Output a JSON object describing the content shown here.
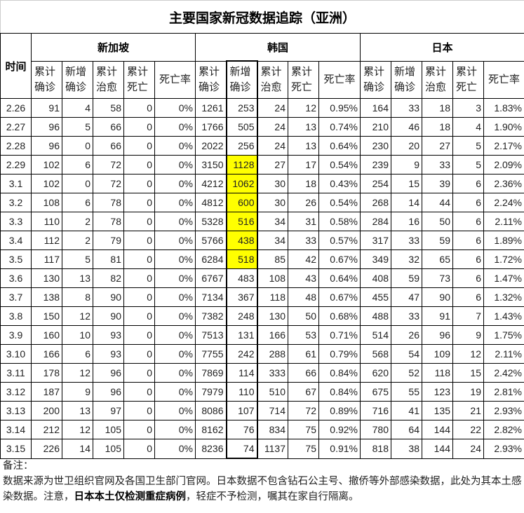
{
  "title": "主要国家新冠数据追踪（亚洲）",
  "time_header": "时间",
  "countries": [
    "新加坡",
    "韩国",
    "日本"
  ],
  "subheaders": [
    "累计确诊",
    "新增确诊",
    "累计治愈",
    "累计死亡",
    "死亡率"
  ],
  "highlight_color": "#ffff00",
  "highlighted_rows": [
    "2.29",
    "3.1",
    "3.2",
    "3.3",
    "3.4",
    "3.5"
  ],
  "rows": [
    [
      "2.26",
      "91",
      "4",
      "58",
      "0",
      "0%",
      "1261",
      "253",
      "24",
      "12",
      "0.95%",
      "164",
      "33",
      "18",
      "3",
      "1.83%"
    ],
    [
      "2.27",
      "96",
      "5",
      "66",
      "0",
      "0%",
      "1766",
      "505",
      "24",
      "13",
      "0.74%",
      "210",
      "46",
      "18",
      "4",
      "1.90%"
    ],
    [
      "2.28",
      "96",
      "0",
      "66",
      "0",
      "0%",
      "2022",
      "256",
      "24",
      "13",
      "0.64%",
      "230",
      "20",
      "27",
      "5",
      "2.17%"
    ],
    [
      "2.29",
      "102",
      "6",
      "72",
      "0",
      "0%",
      "3150",
      "1128",
      "27",
      "17",
      "0.54%",
      "239",
      "9",
      "33",
      "5",
      "2.09%"
    ],
    [
      "3.1",
      "102",
      "0",
      "72",
      "0",
      "0%",
      "4212",
      "1062",
      "30",
      "18",
      "0.43%",
      "254",
      "15",
      "39",
      "6",
      "2.36%"
    ],
    [
      "3.2",
      "108",
      "6",
      "78",
      "0",
      "0%",
      "4812",
      "600",
      "30",
      "26",
      "0.54%",
      "268",
      "14",
      "44",
      "6",
      "2.24%"
    ],
    [
      "3.3",
      "110",
      "2",
      "78",
      "0",
      "0%",
      "5328",
      "516",
      "34",
      "31",
      "0.58%",
      "284",
      "16",
      "50",
      "6",
      "2.11%"
    ],
    [
      "3.4",
      "112",
      "2",
      "79",
      "0",
      "0%",
      "5766",
      "438",
      "34",
      "33",
      "0.57%",
      "317",
      "33",
      "59",
      "6",
      "1.89%"
    ],
    [
      "3.5",
      "117",
      "5",
      "81",
      "0",
      "0%",
      "6284",
      "518",
      "85",
      "42",
      "0.67%",
      "349",
      "32",
      "65",
      "6",
      "1.72%"
    ],
    [
      "3.6",
      "130",
      "13",
      "82",
      "0",
      "0%",
      "6767",
      "483",
      "108",
      "43",
      "0.64%",
      "408",
      "59",
      "73",
      "6",
      "1.47%"
    ],
    [
      "3.7",
      "138",
      "8",
      "90",
      "0",
      "0%",
      "7134",
      "367",
      "118",
      "48",
      "0.67%",
      "455",
      "47",
      "90",
      "6",
      "1.32%"
    ],
    [
      "3.8",
      "150",
      "12",
      "90",
      "0",
      "0%",
      "7382",
      "248",
      "130",
      "50",
      "0.68%",
      "488",
      "33",
      "91",
      "7",
      "1.43%"
    ],
    [
      "3.9",
      "160",
      "10",
      "93",
      "0",
      "0%",
      "7513",
      "131",
      "166",
      "53",
      "0.71%",
      "514",
      "26",
      "96",
      "9",
      "1.75%"
    ],
    [
      "3.10",
      "166",
      "6",
      "93",
      "0",
      "0%",
      "7755",
      "242",
      "288",
      "61",
      "0.79%",
      "568",
      "54",
      "109",
      "12",
      "2.11%"
    ],
    [
      "3.11",
      "178",
      "12",
      "96",
      "0",
      "0%",
      "7869",
      "114",
      "333",
      "66",
      "0.84%",
      "620",
      "52",
      "118",
      "15",
      "2.42%"
    ],
    [
      "3.12",
      "187",
      "9",
      "96",
      "0",
      "0%",
      "7979",
      "110",
      "510",
      "67",
      "0.84%",
      "675",
      "55",
      "123",
      "19",
      "2.81%"
    ],
    [
      "3.13",
      "200",
      "13",
      "97",
      "0",
      "0%",
      "8086",
      "107",
      "714",
      "72",
      "0.89%",
      "716",
      "41",
      "135",
      "21",
      "2.93%"
    ],
    [
      "3.14",
      "212",
      "12",
      "105",
      "0",
      "0%",
      "8162",
      "76",
      "834",
      "75",
      "0.92%",
      "780",
      "64",
      "144",
      "22",
      "2.82%"
    ],
    [
      "3.15",
      "226",
      "14",
      "105",
      "0",
      "0%",
      "8236",
      "74",
      "1137",
      "75",
      "0.91%",
      "818",
      "38",
      "144",
      "24",
      "2.93%"
    ]
  ],
  "notes": {
    "label": "备注：",
    "text_before": "数据来源为世卫组织官网及各国卫生部门官网。日本数据不包含钻石公主号、撤侨等外部感染数据，此处为其本土感染数据。注意，",
    "text_bold": "日本本土仅检测重症病例",
    "text_after": "，轻症不予检测，嘱其在家自行隔离。"
  }
}
